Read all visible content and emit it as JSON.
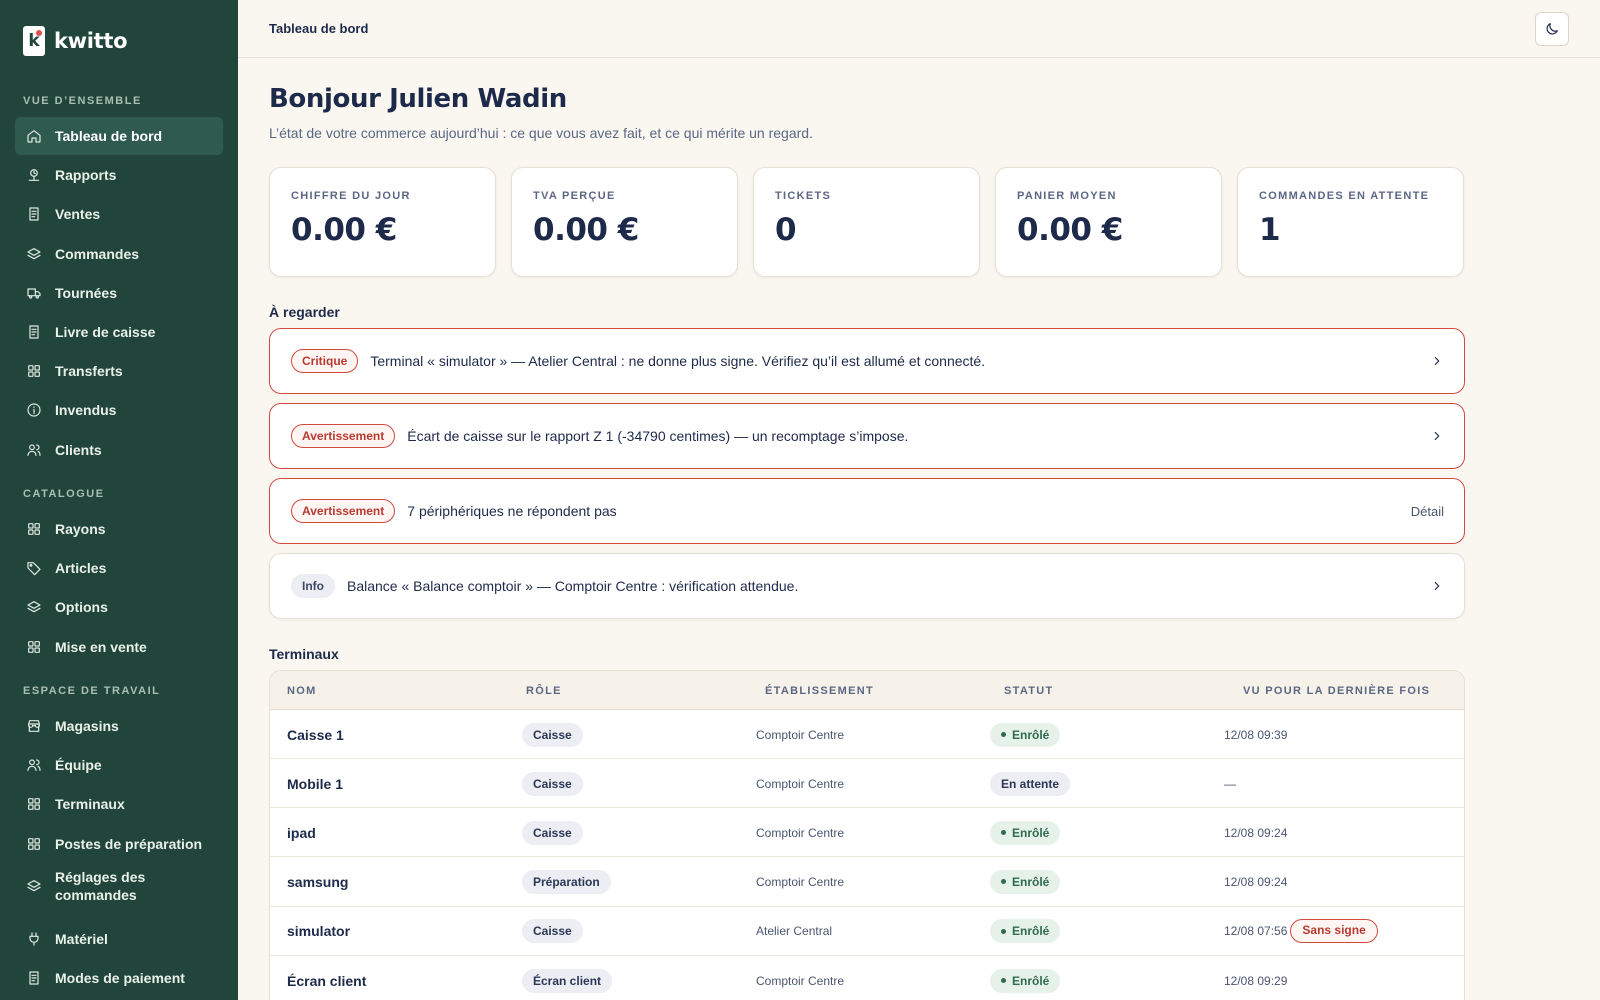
{
  "brand": {
    "name": "kwitto",
    "logo_letter": "k"
  },
  "sidebar": {
    "sections": [
      {
        "title": "VUE D’ENSEMBLE",
        "items": [
          {
            "label": "Tableau de bord",
            "icon": "home-icon",
            "active": true
          },
          {
            "label": "Rapports",
            "icon": "scale-icon"
          },
          {
            "label": "Ventes",
            "icon": "receipt-icon"
          },
          {
            "label": "Commandes",
            "icon": "layers-icon"
          },
          {
            "label": "Tournées",
            "icon": "truck-icon"
          },
          {
            "label": "Livre de caisse",
            "icon": "receipt-icon"
          },
          {
            "label": "Transferts",
            "icon": "grid-icon"
          },
          {
            "label": "Invendus",
            "icon": "info-icon"
          },
          {
            "label": "Clients",
            "icon": "users-icon"
          }
        ]
      },
      {
        "title": "CATALOGUE",
        "items": [
          {
            "label": "Rayons",
            "icon": "grid-icon"
          },
          {
            "label": "Articles",
            "icon": "tag-icon"
          },
          {
            "label": "Options",
            "icon": "layers-icon"
          },
          {
            "label": "Mise en vente",
            "icon": "grid-icon"
          }
        ]
      },
      {
        "title": "ESPACE DE TRAVAIL",
        "items": [
          {
            "label": "Magasins",
            "icon": "store-icon"
          },
          {
            "label": "Équipe",
            "icon": "users-icon"
          },
          {
            "label": "Terminaux",
            "icon": "grid-icon"
          },
          {
            "label": "Postes de préparation",
            "icon": "grid-icon"
          },
          {
            "label": "Réglages des commandes",
            "icon": "layers-icon"
          },
          {
            "label": "Matériel",
            "icon": "plug-icon"
          },
          {
            "label": "Modes de paiement",
            "icon": "receipt-icon"
          }
        ]
      }
    ]
  },
  "header": {
    "breadcrumb": "Tableau de bord",
    "theme_toggle_icon": "moon-icon"
  },
  "main": {
    "greeting": "Bonjour Julien Wadin",
    "subtitle": "L’état de votre commerce aujourd’hui : ce que vous avez fait, et ce qui mérite un regard.",
    "kpis": [
      {
        "label": "CHIFFRE DU JOUR",
        "value": "0.00 €"
      },
      {
        "label": "TVA PERÇUE",
        "value": "0.00 €"
      },
      {
        "label": "TICKETS",
        "value": "0"
      },
      {
        "label": "PANIER MOYEN",
        "value": "0.00 €"
      },
      {
        "label": "COMMANDES EN ATTENTE",
        "value": "1"
      }
    ],
    "watch_title": "À regarder",
    "alerts": [
      {
        "level": "Critique",
        "severity": "critical",
        "text": "Terminal « simulator » — Atelier Central : ne donne plus signe. Vérifiez qu’il est allumé et connecté.",
        "action": "chevron"
      },
      {
        "level": "Avertissement",
        "severity": "warning",
        "text": "Écart de caisse sur le rapport Z 1 (-34790 centimes) — un recomptage s’impose.",
        "action": "chevron"
      },
      {
        "level": "Avertissement",
        "severity": "warning",
        "text": "7 périphériques ne répondent pas",
        "action_label": "Détail"
      },
      {
        "level": "Info",
        "severity": "info",
        "text": "Balance « Balance comptoir » — Comptoir Centre : vérification attendue.",
        "action": "chevron"
      }
    ],
    "terminals_title": "Terminaux",
    "table": {
      "columns": [
        "NOM",
        "RÔLE",
        "ÉTABLISSEMENT",
        "STATUT",
        "VU POUR LA DERNIÈRE FOIS"
      ],
      "rows": [
        {
          "name": "Caisse 1",
          "role": "Caisse",
          "site": "Comptoir Centre",
          "status": "Enrôlé",
          "status_kind": "ok",
          "last_seen": "12/08 09:39"
        },
        {
          "name": "Mobile 1",
          "role": "Caisse",
          "site": "Comptoir Centre",
          "status": "En attente",
          "status_kind": "wait",
          "last_seen": "—"
        },
        {
          "name": "ipad",
          "role": "Caisse",
          "site": "Comptoir Centre",
          "status": "Enrôlé",
          "status_kind": "ok",
          "last_seen": "12/08 09:24"
        },
        {
          "name": "samsung",
          "role": "Préparation",
          "site": "Comptoir Centre",
          "status": "Enrôlé",
          "status_kind": "ok",
          "last_seen": "12/08 09:24"
        },
        {
          "name": "simulator",
          "role": "Caisse",
          "site": "Atelier Central",
          "status": "Enrôlé",
          "status_kind": "ok",
          "last_seen": "12/08 07:56",
          "warning": "Sans signe"
        },
        {
          "name": "Écran client",
          "role": "Écran client",
          "site": "Comptoir Centre",
          "status": "Enrôlé",
          "status_kind": "ok",
          "last_seen": "12/08 09:29"
        }
      ]
    }
  },
  "colors": {
    "sidebar_bg": "#21453a",
    "sidebar_active": "#2e5b4d",
    "page_bg": "#faf7f0",
    "text_primary": "#1e2a4a",
    "critical": "#cf4a40",
    "success": "#2f6b4c"
  }
}
